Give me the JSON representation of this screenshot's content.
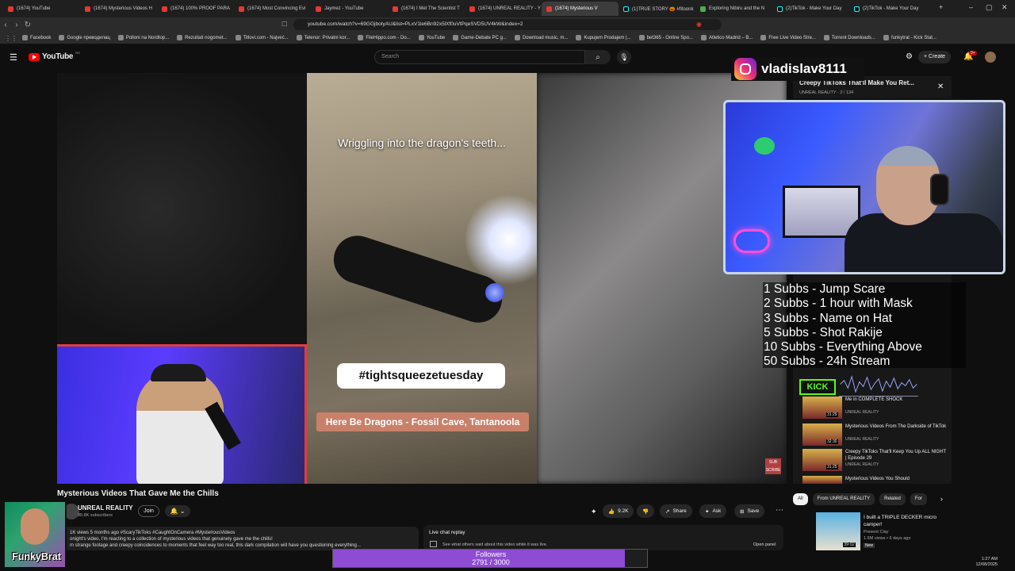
{
  "browser": {
    "tabs": [
      {
        "label": "(1674) YouTube",
        "icon": "youtube-icon"
      },
      {
        "label": "(1674) Mysterious Videos H",
        "icon": "youtube-icon"
      },
      {
        "label": "(1674) 100% PROOF PARA",
        "icon": "youtube-icon"
      },
      {
        "label": "(1674) Most Convincing Evi",
        "icon": "youtube-icon"
      },
      {
        "label": "Jaymez - YouTube",
        "icon": "youtube-icon"
      },
      {
        "label": "(1674) I Met The Scientist T",
        "icon": "youtube-icon"
      },
      {
        "label": "(1674) UNREAL REALITY - Y",
        "icon": "youtube-icon"
      },
      {
        "label": "(1674) Mysterious V",
        "icon": "youtube-icon",
        "active": true
      },
      {
        "label": "(1)TRUE STORY 🎃 #fitoonk",
        "icon": "tiktok-icon"
      },
      {
        "label": "Exploring Nibiru and the N",
        "icon": "globe-icon"
      },
      {
        "label": "(2)TikTok - Make Your Day",
        "icon": "tiktok-icon"
      },
      {
        "label": "(2)TikTok - Make Your Day",
        "icon": "tiktok-icon"
      }
    ],
    "url": "youtube.com/watch?v=69GGjboIyAU&list=PLxV1le6Bn92x5lXf0uVtPqeSVD5UV4kW&index=2",
    "bookmarks": [
      "Facebook",
      "Google преводилац",
      "Polloni na Nordtop...",
      "Rezultati nogomet...",
      "Titlovi.com - Najveć...",
      "Telenor: Privatni kor...",
      "FileHippo.com - Do...",
      "YouTube",
      "Game-Debate PC g...",
      "Download music, m...",
      "Kupujem Prodajem |...",
      "bet365 - Online Spo...",
      "Atletico Madrid – B...",
      "Free Live Video Stre...",
      "Torrent Downloads...",
      "funkytrat - Kick Stat..."
    ]
  },
  "youtube": {
    "logo": "YouTube",
    "logo_region": "RS",
    "search_placeholder": "Search",
    "create_label": "Create",
    "notif_count": "9+"
  },
  "video": {
    "caption_top": "Wriggling into the dragon's teeth...",
    "hashtag": "#tightsqueezetuesday",
    "caption_location": "Here Be Dragons - Fossil Cave, Tantanoola",
    "subscribe_corner": "SUB SCRIBE",
    "title": "Mysterious Videos That Gave Me the Chills",
    "channel": "UNREAL REALITY",
    "subscribers": "90.8K subscribers",
    "join_label": "Join",
    "likes": "9.2K",
    "share_label": "Share",
    "ask_label": "Ask",
    "save_label": "Save",
    "desc_stats": "1K views  5 months ago  #ScaryTikToks #CaughtOnCamera #MysteriousVideos",
    "desc_line2": "onight's video, I'm reacting to a collection of mysterious videos that genuinely gave me the chills!",
    "desc_line3": "m strange footage and creepy coincidences to moments that feel way too real, this dark compilation will have you questioning everything..."
  },
  "livechat": {
    "title": "Live chat replay",
    "subtitle": "See what others said about this video while it was live.",
    "open_label": "Open panel"
  },
  "playlist": {
    "title": "Creepy TikToks That'll Make You Ret...",
    "meta": "UNREAL REALITY - 2 / 134",
    "items": [
      {
        "title": "Me in COMPLETE SHOCK",
        "channel": "UNREAL REALITY",
        "duration": "31:29"
      },
      {
        "title": "Mysterious Videos From The Darkside of TikTok",
        "channel": "UNREAL REALITY",
        "duration": "32:30"
      },
      {
        "title": "Creepy TikToks That'll Keep You Up ALL NIGHT | Episode 29",
        "channel": "UNREAL REALITY",
        "duration": "31:25"
      },
      {
        "title": "Mysterious Videos You Should",
        "channel": "",
        "duration": ""
      }
    ]
  },
  "chips": [
    "All",
    "From UNREAL REALITY",
    "Related",
    "For"
  ],
  "recommended": {
    "title": "I built a TRIPLE DECKER micro camper!",
    "channel": "Present Clay",
    "views": "1.6M views • 6 days ago",
    "badge": "New",
    "duration": "39:02"
  },
  "overlay": {
    "instagram": "vladislav8111",
    "goals": [
      "1 Subbs - Jump Scare",
      "2 Subbs - 1 hour with Mask",
      "3 Subbs - Name on Hat",
      "5 Subbs - Shot Rakije",
      "10 Subbs - Everything Above",
      "50 Subbs - 24h Stream"
    ],
    "kick": "KICK",
    "streamer_name": "FunkyBrat",
    "followers_label": "Followers",
    "followers_value": "2791 / 3000",
    "followers_current": 2791,
    "followers_goal": 3000
  },
  "taskbar": {
    "time": "1:27 AM",
    "date": "12/08/2025"
  },
  "colors": {
    "accent_red": "#e53935",
    "kick_green": "#53fc18",
    "followers_purple": "#8e4bd4"
  }
}
